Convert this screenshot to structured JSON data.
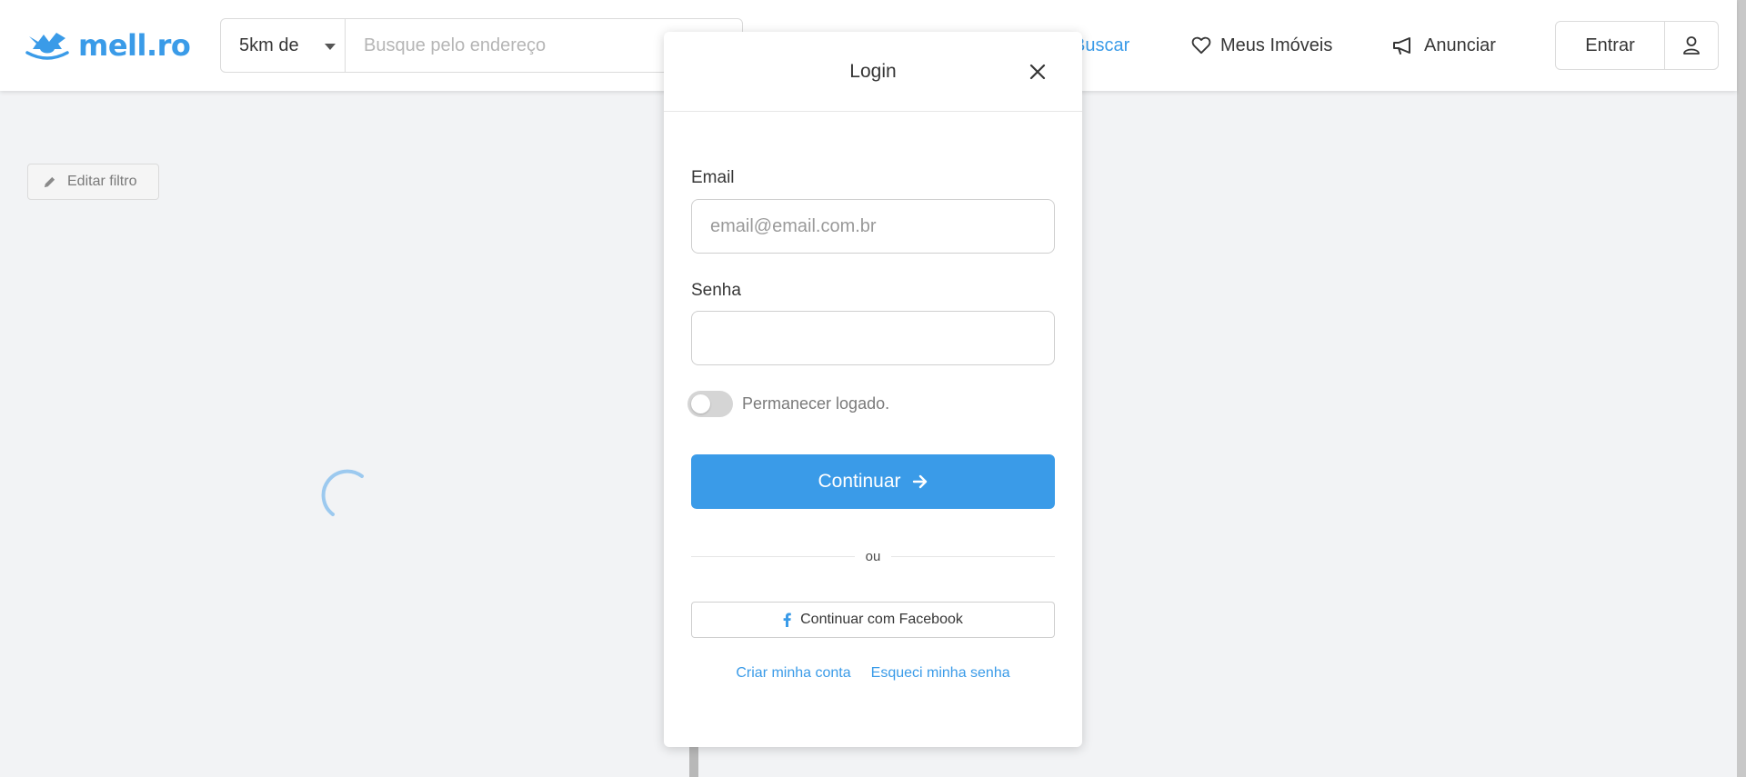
{
  "header": {
    "logo_text": "mell.ro",
    "distance_select": "5km de",
    "search_placeholder": "Busque pelo endereço",
    "nav": {
      "buscar": "Buscar",
      "meus_imoveis": "Meus Imóveis",
      "anunciar": "Anunciar"
    },
    "entrar_label": "Entrar"
  },
  "main": {
    "edit_filter_label": "Editar filtro"
  },
  "login_modal": {
    "title": "Login",
    "email_label": "Email",
    "email_placeholder": "email@email.com.br",
    "password_label": "Senha",
    "password_value": "",
    "remember_label": "Permanecer logado.",
    "remember_on": false,
    "continue_label": "Continuar",
    "or_label": "ou",
    "facebook_label": "Continuar com Facebook",
    "create_account_link": "Criar minha conta",
    "forgot_password_link": "Esqueci minha senha"
  },
  "colors": {
    "brand": "#3a9be8",
    "background": "#f2f3f5",
    "text": "#363636"
  }
}
